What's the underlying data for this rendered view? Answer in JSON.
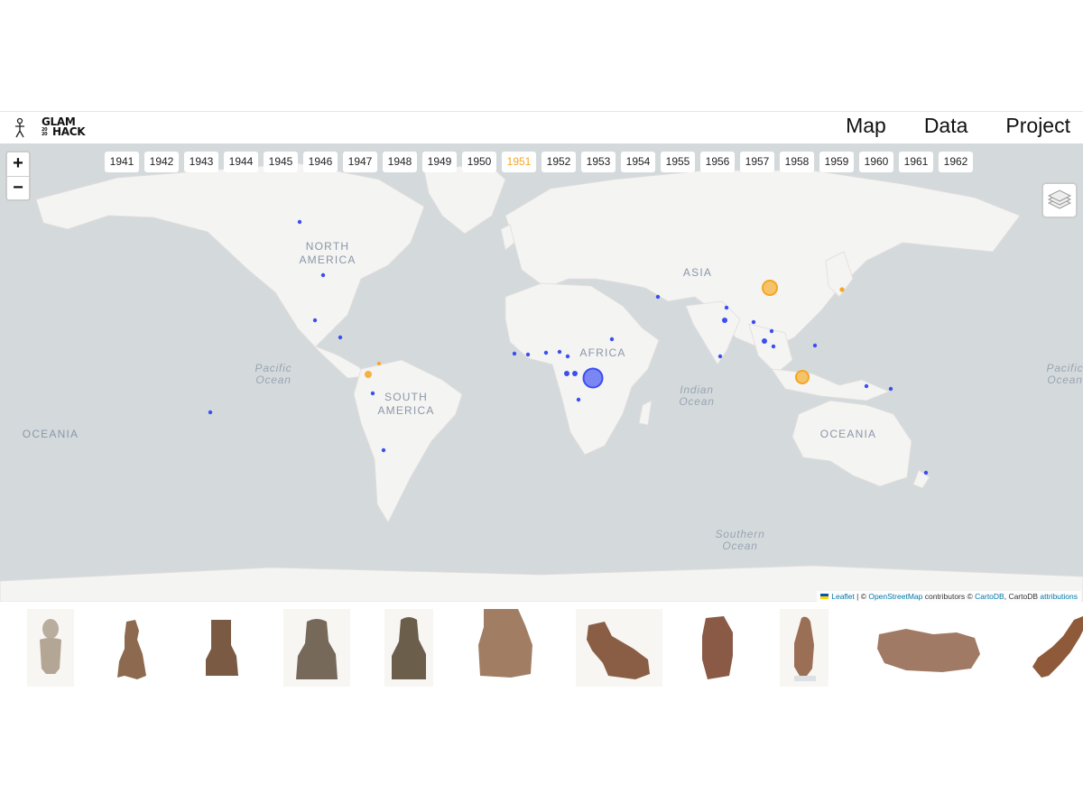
{
  "header": {
    "logo_line1": "GLAM",
    "logo_line2": "HACK",
    "logo_small": "20 20",
    "nav": [
      {
        "label": "Map"
      },
      {
        "label": "Data"
      },
      {
        "label": "Project"
      }
    ]
  },
  "map": {
    "zoom_in": "+",
    "zoom_out": "−",
    "years": [
      "1941",
      "1942",
      "1943",
      "1944",
      "1945",
      "1946",
      "1947",
      "1948",
      "1949",
      "1950",
      "1951",
      "1952",
      "1953",
      "1954",
      "1955",
      "1956",
      "1957",
      "1958",
      "1959",
      "1960",
      "1961",
      "1962"
    ],
    "selected_year": "1951",
    "labels": {
      "north_america": [
        "NORTH",
        "AMERICA"
      ],
      "south_america": [
        "SOUTH",
        "AMERICA"
      ],
      "africa": "AFRICA",
      "asia": "ASIA",
      "oceania": "OCEANIA",
      "pacific": [
        "Pacific",
        "Ocean"
      ],
      "indian": [
        "Indian",
        "Ocean"
      ],
      "southern": [
        "Southern",
        "Ocean"
      ]
    },
    "layers_icon": "layers-icon",
    "colors": {
      "default_marker": "#3b4ef0",
      "selected_marker": "#f5a623",
      "land": "#f4f4f2",
      "water": "#d4dadc"
    },
    "attribution": {
      "leaflet": "Leaflet",
      "sep1": " | © ",
      "osm": "OpenStreetMap",
      "mid": " contributors © ",
      "cartodb": "CartoDB",
      "mid2": ", CartoDB ",
      "attr": "attributions"
    }
  },
  "gallery": {
    "items": [
      {
        "name": "figurine-1"
      },
      {
        "name": "figurine-2"
      },
      {
        "name": "figurine-3"
      },
      {
        "name": "figurine-4"
      },
      {
        "name": "figurine-5"
      },
      {
        "name": "figurine-6"
      },
      {
        "name": "figurine-7"
      },
      {
        "name": "figurine-8"
      },
      {
        "name": "figurine-9"
      },
      {
        "name": "figurine-10"
      },
      {
        "name": "figurine-11"
      }
    ]
  }
}
